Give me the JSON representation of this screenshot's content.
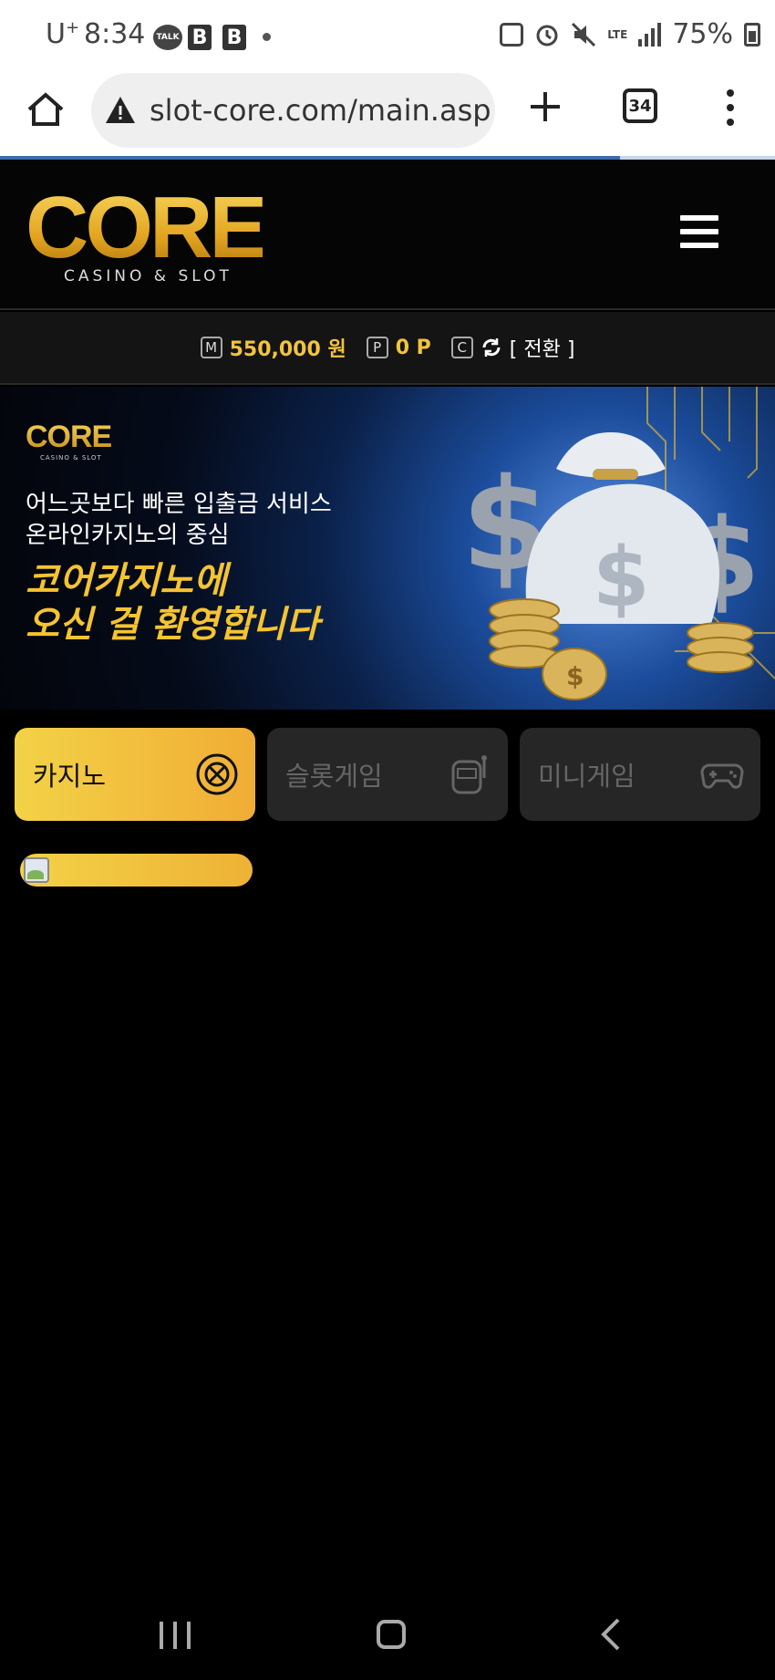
{
  "status_bar": {
    "carrier": "U",
    "carrier_sup": "+",
    "time": "8:34",
    "talk": "TALK",
    "b1": "B",
    "b2": "B",
    "lte": "LTE",
    "battery": "75%"
  },
  "browser": {
    "url": "slot-core.com/main.asp",
    "tab_count": "34"
  },
  "header": {
    "logo_word": "CORE",
    "logo_sub": "CASINO & SLOT"
  },
  "balance": {
    "money_icon": "M",
    "money": "550,000 원",
    "point_icon": "P",
    "points": "0 P",
    "coin_icon": "C",
    "switch_label": "[ 전환 ]"
  },
  "banner": {
    "logo": "CORE",
    "logo_sub": "CASINO & SLOT",
    "line1": "어느곳보다 빠른 입출금 서비스",
    "line2": "온라인카지노의 중심",
    "headline1": "코어카지노에",
    "headline2": "오신 걸 환영합니다"
  },
  "categories": [
    {
      "label": "카지노",
      "icon": "roulette-icon",
      "active": true
    },
    {
      "label": "슬롯게임",
      "icon": "slot-machine-icon",
      "active": false
    },
    {
      "label": "미니게임",
      "icon": "gamepad-icon",
      "active": false
    }
  ],
  "colors": {
    "accent_gold": "#f2c43d",
    "background": "#000000",
    "tab_inactive": "#262626"
  }
}
